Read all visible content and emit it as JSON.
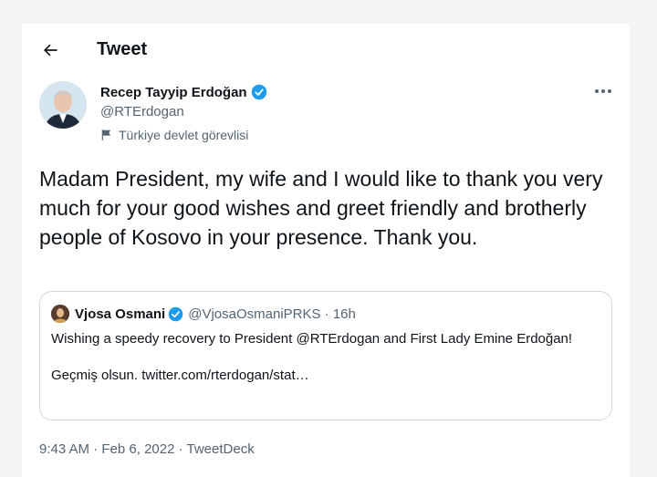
{
  "header": {
    "back_icon": "arrow-left-icon",
    "title": "Tweet"
  },
  "author": {
    "display_name": "Recep Tayyip Erdoğan",
    "handle": "@RTErdogan",
    "label": "Türkiye devlet görevlisi",
    "label_icon": "flag-icon",
    "verified_icon": "verified-badge-icon",
    "more_icon": "more-horizontal-icon"
  },
  "tweet": {
    "text": "Madam President, my wife and I would like to thank you very much for your good wishes and greet friendly and brotherly people of Kosovo in your presence. Thank you."
  },
  "quote": {
    "display_name": "Vjosa Osmani",
    "handle": "@VjosaOsmaniPRKS",
    "separator": " · ",
    "age": "16h",
    "text_line1": "Wishing a speedy recovery to President @RTErdogan and First Lady Emine Erdoğan!",
    "text_line2": "Geçmiş olsun. twitter.com/rterdogan/stat…"
  },
  "meta": {
    "time": "9:43 AM",
    "separator": " · ",
    "date": "Feb 6, 2022",
    "source": "TweetDeck"
  },
  "colors": {
    "text_primary": "#0f1419",
    "text_secondary": "#536471",
    "verified_blue": "#1d9bf0",
    "border": "#cfd9de"
  }
}
